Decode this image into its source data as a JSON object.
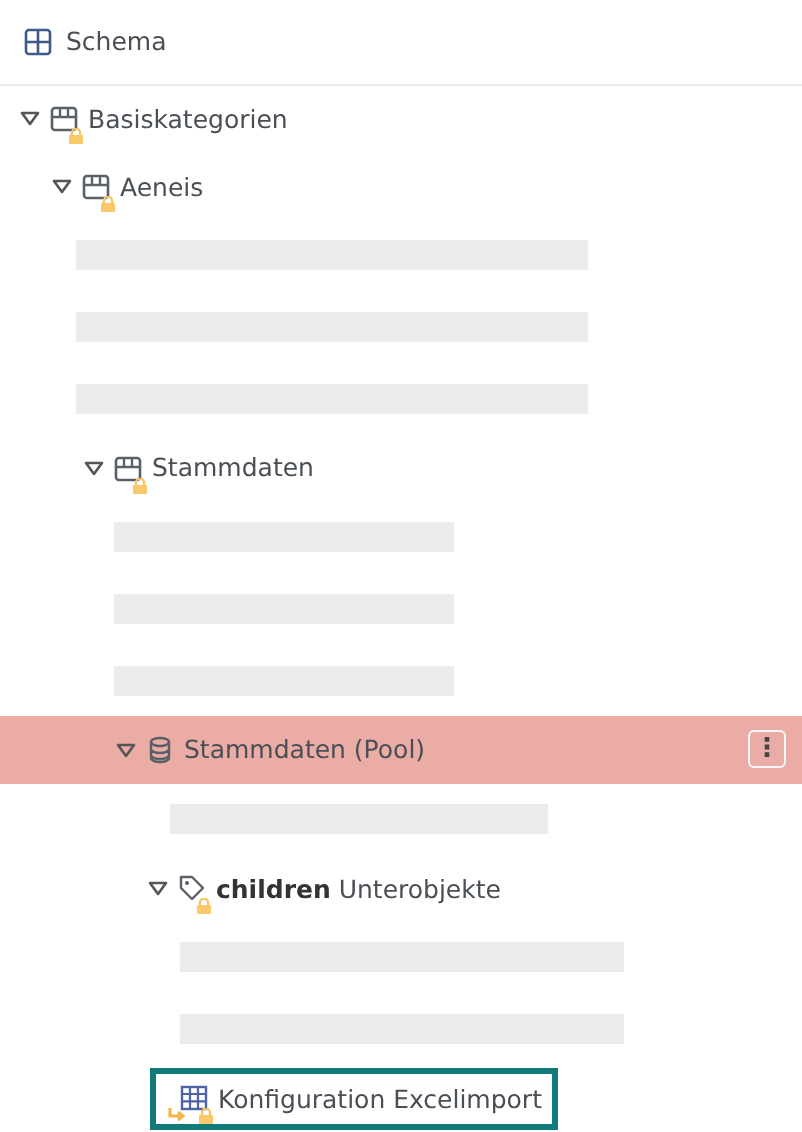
{
  "header": {
    "title": "Schema"
  },
  "tree": [
    {
      "kind": "category",
      "label": "Basiskategorien",
      "expanded": true,
      "locked": true,
      "linked": false,
      "selected": false,
      "focused": false,
      "children": [
        {
          "kind": "category",
          "label": "Aeneis",
          "expanded": true,
          "locked": true,
          "linked": false,
          "selected": false,
          "focused": false,
          "children": [
            {
              "kind": "skeleton"
            },
            {
              "kind": "skeleton"
            },
            {
              "kind": "skeleton"
            },
            {
              "kind": "category",
              "label": "Stammdaten",
              "expanded": true,
              "locked": true,
              "linked": false,
              "selected": false,
              "focused": false,
              "children": [
                {
                  "kind": "skeleton"
                },
                {
                  "kind": "skeleton"
                },
                {
                  "kind": "skeleton"
                },
                {
                  "kind": "pool",
                  "label": "Stammdaten (Pool)",
                  "expanded": true,
                  "locked": false,
                  "linked": false,
                  "selected": true,
                  "focused": false,
                  "menu": "⋮",
                  "children": [
                    {
                      "kind": "skeleton"
                    },
                    {
                      "kind": "attribute",
                      "label": "**children** Unterobjekte",
                      "expanded": true,
                      "locked": true,
                      "linked": false,
                      "selected": false,
                      "focused": false,
                      "children": [
                        {
                          "kind": "skeleton"
                        },
                        {
                          "kind": "skeleton"
                        },
                        {
                          "kind": "table",
                          "label": "Konfiguration Excelimport",
                          "locked": true,
                          "linked": true,
                          "selected": false,
                          "focused": true
                        }
                      ]
                    }
                  ]
                }
              ]
            }
          ]
        }
      ]
    }
  ]
}
